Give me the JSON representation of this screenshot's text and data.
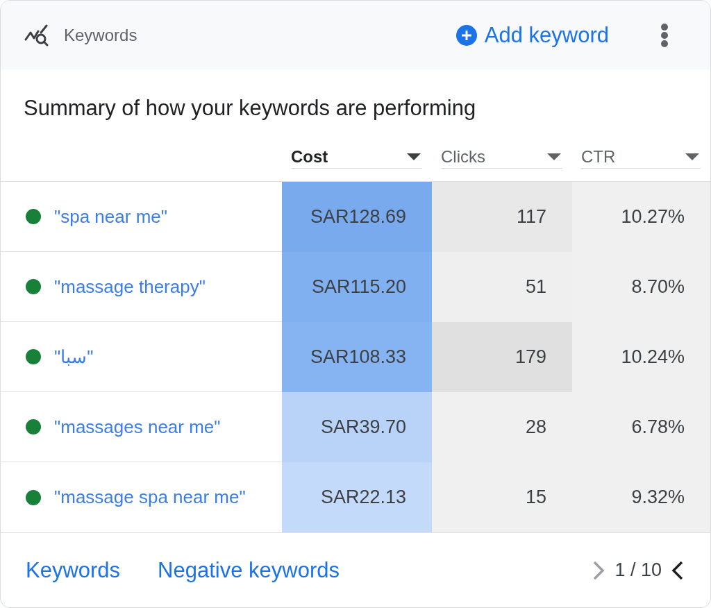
{
  "header": {
    "title": "Keywords",
    "add_button": "Add keyword"
  },
  "summary": "Summary of how your keywords are performing",
  "table": {
    "columns": [
      {
        "label": "Cost",
        "selected": true
      },
      {
        "label": "Clicks",
        "selected": false
      },
      {
        "label": "CTR",
        "selected": false
      }
    ],
    "rows": [
      {
        "keyword": "\"spa near me\"",
        "color": "#188038",
        "cells": [
          {
            "text": "SAR128.69",
            "color": "#7aaaee"
          },
          {
            "text": "117",
            "color": "#e8e8e8"
          },
          {
            "text": "10.27%",
            "color": "#f0f0f0"
          }
        ]
      },
      {
        "keyword": "\"massage therapy\"",
        "color": "#188038",
        "cells": [
          {
            "text": "SAR115.20",
            "color": "#80b0f0"
          },
          {
            "text": "51",
            "color": "#efefef"
          },
          {
            "text": "8.70%",
            "color": "#f0f0f0"
          }
        ]
      },
      {
        "keyword": "\"سبا\"",
        "color": "#188038",
        "cells": [
          {
            "text": "SAR108.33",
            "color": "#86b4f2"
          },
          {
            "text": "179",
            "color": "#e0e0e0"
          },
          {
            "text": "10.24%",
            "color": "#f0f0f0"
          }
        ]
      },
      {
        "keyword": "\"massages near me\"",
        "color": "#188038",
        "cells": [
          {
            "text": "SAR39.70",
            "color": "#b9d3f8"
          },
          {
            "text": "28",
            "color": "#f0f0f0"
          },
          {
            "text": "6.78%",
            "color": "#f0f0f0"
          }
        ]
      },
      {
        "keyword": "\"massage spa near me\"",
        "color": "#188038",
        "cells": [
          {
            "text": "SAR22.13",
            "color": "#c4dafa"
          },
          {
            "text": "15",
            "color": "#f0f0f0"
          },
          {
            "text": "9.32%",
            "color": "#f0f0f0"
          }
        ]
      }
    ]
  },
  "footer": {
    "links": [
      "Keywords",
      "Negative keywords"
    ],
    "pager": {
      "text": "1 / 10",
      "left_arrow": {
        "disabled": true
      },
      "right_arrow": {
        "disabled": false
      }
    }
  }
}
